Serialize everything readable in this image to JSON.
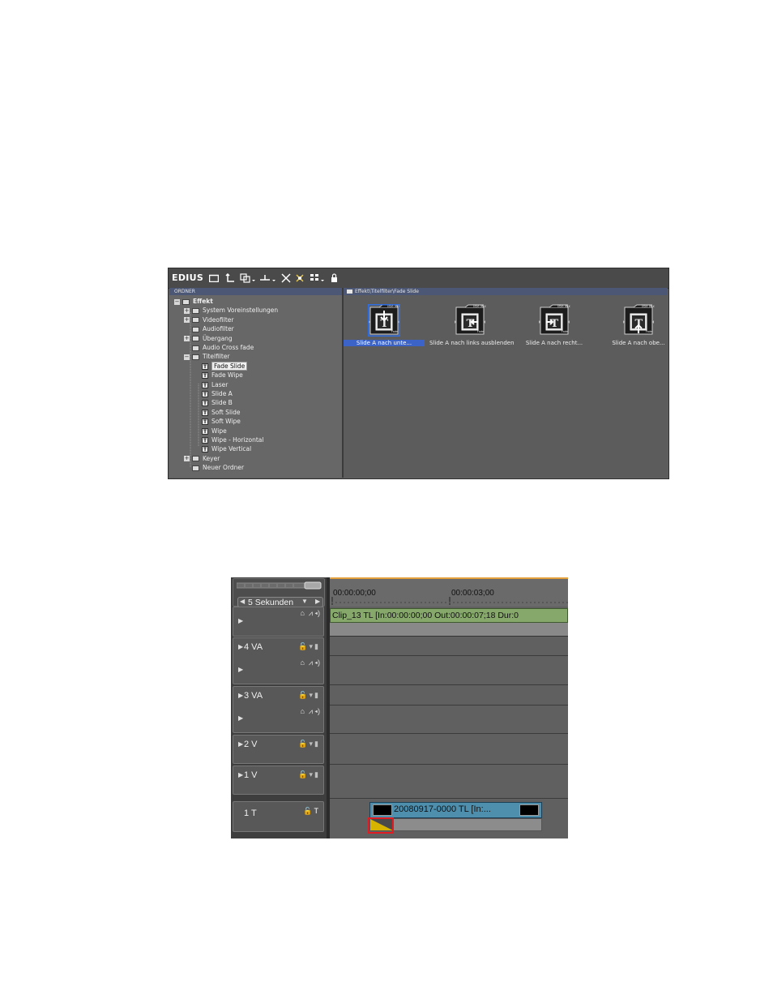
{
  "effect_panel": {
    "app_name": "EDIUS",
    "toolbar_icons": [
      "folder-icon",
      "up-folder-icon",
      "copy-icon",
      "dropdown-icon",
      "delete-icon",
      "properties-icon",
      "view-mode-icon",
      "lock-icon"
    ],
    "tree_header": "ORDNER",
    "path": "Effekt\\Titelfilter\\Fade Slide",
    "tree": [
      {
        "label": "Effekt",
        "expander": "−",
        "type": "folder",
        "level": 0
      },
      {
        "label": "System Voreinstellungen",
        "expander": "+",
        "type": "folder",
        "level": 1
      },
      {
        "label": "Videofilter",
        "expander": "+",
        "type": "folder",
        "level": 1
      },
      {
        "label": "Audiofilter",
        "expander": "",
        "type": "folder",
        "level": 1
      },
      {
        "label": "Übergang",
        "expander": "+",
        "type": "folder",
        "level": 1
      },
      {
        "label": "Audio Cross fade",
        "expander": "",
        "type": "folder",
        "level": 1
      },
      {
        "label": "Titelfilter",
        "expander": "−",
        "type": "folder",
        "level": 1
      },
      {
        "label": "Fade Slide",
        "expander": "",
        "type": "title",
        "level": 2,
        "selected": true
      },
      {
        "label": "Fade Wipe",
        "expander": "",
        "type": "title",
        "level": 2
      },
      {
        "label": "Laser",
        "expander": "",
        "type": "title",
        "level": 2
      },
      {
        "label": "Slide A",
        "expander": "",
        "type": "title",
        "level": 2
      },
      {
        "label": "Slide B",
        "expander": "",
        "type": "title",
        "level": 2
      },
      {
        "label": "Soft Slide",
        "expander": "",
        "type": "title",
        "level": 2
      },
      {
        "label": "Soft Wipe",
        "expander": "",
        "type": "title",
        "level": 2
      },
      {
        "label": "Wipe",
        "expander": "",
        "type": "title",
        "level": 2
      },
      {
        "label": "Wipe - Horizontal",
        "expander": "",
        "type": "title",
        "level": 2
      },
      {
        "label": "Wipe Vertical",
        "expander": "",
        "type": "title",
        "level": 2
      },
      {
        "label": "Keyer",
        "expander": "+",
        "type": "folder",
        "level": 1
      },
      {
        "label": "Neuer Ordner",
        "expander": "",
        "type": "folder",
        "level": 1
      }
    ],
    "effects": [
      {
        "label": "Slide A nach unte...",
        "direction": "down",
        "selected": true
      },
      {
        "label": "Slide A nach links ausblenden",
        "direction": "left",
        "selected": false
      },
      {
        "label": "Slide A nach recht...",
        "direction": "right",
        "selected": false
      },
      {
        "label": "Slide A nach obe...",
        "direction": "up",
        "selected": false
      }
    ],
    "thumb_tab_text": "Title Mix",
    "thumb_corner_text": "Fade",
    "thumb_letter": "T"
  },
  "timeline": {
    "scale_label": "5 Sekunden",
    "timecodes": [
      "00:00:00;00",
      "00:00:03;00"
    ],
    "tracks": [
      {
        "name": "",
        "type": "audio-sub"
      },
      {
        "name": "4 VA",
        "type": "va"
      },
      {
        "name": "3 VA",
        "type": "va"
      },
      {
        "name": "2 V",
        "type": "v"
      },
      {
        "name": "1 V",
        "type": "v"
      },
      {
        "name": "1 T",
        "type": "t"
      }
    ],
    "clip_main_label": "Clip_13  TL [In:00:00:00;00 Out:00:00:07;18 Dur:0",
    "clip_title_label": "20080917-0000  TL [In:...",
    "colors": {
      "accent_orange": "#e3a03b",
      "clip_green": "#86a86a",
      "clip_title_blue": "#4f8fae",
      "selection_red": "#e11b22",
      "fade_yellow": "#d6b400"
    }
  }
}
